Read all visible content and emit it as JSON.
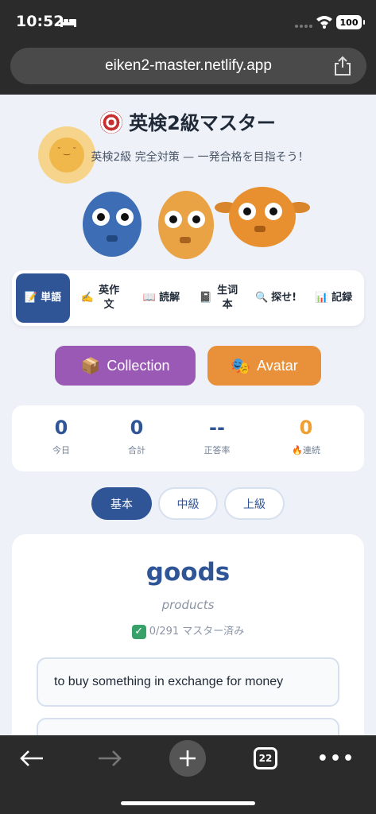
{
  "status_bar": {
    "time": "10:52",
    "battery": "100"
  },
  "browser": {
    "url": "eiken2-master.netlify.app",
    "tab_count": "22"
  },
  "header": {
    "title": "英検2級マスター",
    "subtitle": "英検2級 完全対策 — 一発合格を目指そう！",
    "title_icon": "target-icon"
  },
  "nav": {
    "items": [
      {
        "icon": "📝",
        "label": "単語",
        "active": true
      },
      {
        "icon": "✍️",
        "label": "英作文",
        "active": false
      },
      {
        "icon": "📖",
        "label": "読解",
        "active": false
      },
      {
        "icon": "📓",
        "label": "生词本",
        "active": false
      },
      {
        "icon": "🔍",
        "label": "探せ!",
        "active": false
      },
      {
        "icon": "📊",
        "label": "記録",
        "active": false
      }
    ]
  },
  "actions": {
    "collection": {
      "icon": "📦",
      "label": "Collection",
      "color": "#9b59b6"
    },
    "avatar": {
      "icon": "🎭",
      "label": "Avatar",
      "color": "#e8913a"
    }
  },
  "stats": [
    {
      "value": "0",
      "label": "今日"
    },
    {
      "value": "0",
      "label": "合計"
    },
    {
      "value": "--",
      "label": "正答率"
    },
    {
      "value": "0",
      "label": "🔥連続"
    }
  ],
  "levels": [
    {
      "label": "基本",
      "active": true
    },
    {
      "label": "中級",
      "active": false
    },
    {
      "label": "上級",
      "active": false
    }
  ],
  "word_card": {
    "word": "goods",
    "hint": "products",
    "mastery": "0/291 マスター済み",
    "choices": [
      "to buy something in exchange for money",
      ""
    ]
  },
  "colors": {
    "primary": "#2f5597",
    "accent_orange": "#f0a030",
    "background": "#eef2f8"
  }
}
